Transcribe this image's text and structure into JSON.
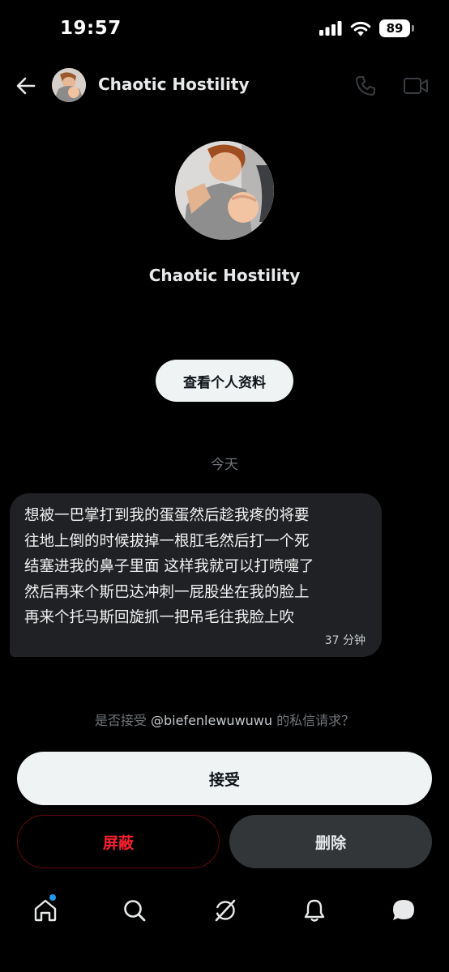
{
  "status_bar": {
    "time": "19:57",
    "battery": "89",
    "icons": [
      "cellular-signal-icon",
      "wifi-icon",
      "battery-icon"
    ]
  },
  "header": {
    "back_icon": "back-arrow-icon",
    "name": "Chaotic Hostility",
    "actions": [
      "phone-icon",
      "video-icon"
    ]
  },
  "profile": {
    "name": "Chaotic Hostility",
    "view_profile_label": "查看个人资料"
  },
  "conversation": {
    "date_label": "今天",
    "messages": [
      {
        "text": "想被一巴掌打到我的蛋蛋然后趁我疼的将要\n往地上倒的时候拔掉一根肛毛然后打一个死\n结塞进我的鼻子里面 这样我就可以打喷嚏了\n然后再来个斯巴达冲刺一屁股坐在我的脸上\n再来个托马斯回旋抓一把吊毛往我脸上吹",
        "time": "37 分钟"
      }
    ]
  },
  "request": {
    "prompt_prefix": "是否接受 ",
    "handle": "@biefenlewuwuwu",
    "prompt_suffix": " 的私信请求？",
    "accept_label": "接受",
    "block_label": "屏蔽",
    "delete_label": "删除"
  },
  "bottom_nav": {
    "items": [
      "home-icon",
      "search-icon",
      "grok-icon",
      "notifications-icon",
      "messages-icon"
    ],
    "home_has_badge": true
  },
  "colors": {
    "background": "#000000",
    "bubble": "#1f2124",
    "accent_blue": "#1d9bf0",
    "danger_red": "#f4212e"
  }
}
